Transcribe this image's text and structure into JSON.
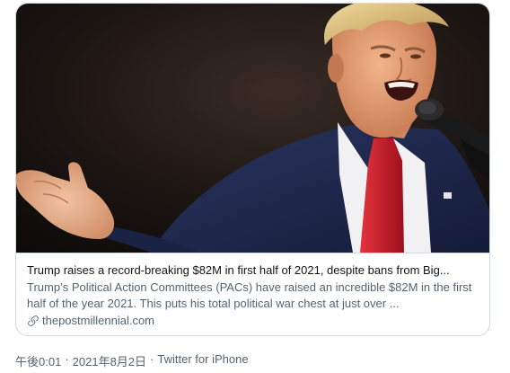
{
  "card": {
    "title": "Trump raises a record-breaking $82M in first half of 2021, despite bans from Big...",
    "description": "Trump’s Political Action Committees (PACs) have raised an incredible $82M in the first half of the year 2021. This puts his total political war chest at just over ...",
    "domain": "thepostmillennial.com",
    "image_icon": "photo-of-speaker-at-podium"
  },
  "meta": {
    "time": "午後0:01",
    "separator": "·",
    "date": "2021年8月2日",
    "source": "Twitter for iPhone"
  },
  "colors": {
    "border": "#cfd9de",
    "primary_text": "#0f1419",
    "secondary_text": "#536471",
    "tie_red": "#d11a2a",
    "suit_navy": "#1f2a4e"
  }
}
